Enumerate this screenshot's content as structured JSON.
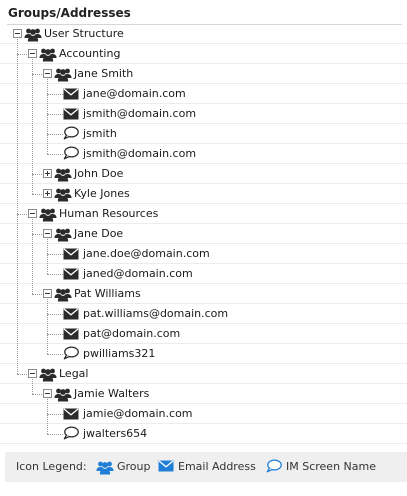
{
  "header": {
    "title": "Groups/Addresses"
  },
  "tree": [
    {
      "depth": 0,
      "icon": "group",
      "label": "User Structure",
      "toggle": "minus"
    },
    {
      "depth": 1,
      "icon": "group",
      "label": "Accounting",
      "toggle": "minus"
    },
    {
      "depth": 2,
      "icon": "group",
      "label": "Jane Smith",
      "toggle": "minus"
    },
    {
      "depth": 3,
      "icon": "email",
      "label": "jane@domain.com"
    },
    {
      "depth": 3,
      "icon": "email",
      "label": "jsmith@domain.com"
    },
    {
      "depth": 3,
      "icon": "im",
      "label": "jsmith"
    },
    {
      "depth": 3,
      "icon": "im",
      "label": "jsmith@domain.com"
    },
    {
      "depth": 2,
      "icon": "group",
      "label": "John Doe",
      "toggle": "plus"
    },
    {
      "depth": 2,
      "icon": "group",
      "label": "Kyle Jones",
      "toggle": "plus"
    },
    {
      "depth": 1,
      "icon": "group",
      "label": "Human Resources",
      "toggle": "minus"
    },
    {
      "depth": 2,
      "icon": "group",
      "label": "Jane Doe",
      "toggle": "minus"
    },
    {
      "depth": 3,
      "icon": "email",
      "label": "jane.doe@domain.com"
    },
    {
      "depth": 3,
      "icon": "email",
      "label": "janed@domain.com"
    },
    {
      "depth": 2,
      "icon": "group",
      "label": "Pat Williams",
      "toggle": "minus"
    },
    {
      "depth": 3,
      "icon": "email",
      "label": "pat.williams@domain.com"
    },
    {
      "depth": 3,
      "icon": "email",
      "label": "pat@domain.com"
    },
    {
      "depth": 3,
      "icon": "im",
      "label": "pwilliams321"
    },
    {
      "depth": 1,
      "icon": "group",
      "label": "Legal",
      "toggle": "minus"
    },
    {
      "depth": 2,
      "icon": "group",
      "label": "Jamie Walters",
      "toggle": "minus"
    },
    {
      "depth": 3,
      "icon": "email",
      "label": "jamie@domain.com"
    },
    {
      "depth": 3,
      "icon": "im",
      "label": "jwalters654"
    }
  ],
  "legend": {
    "title": "Icon Legend:",
    "items": [
      {
        "icon": "group",
        "label": "Group"
      },
      {
        "icon": "email",
        "label": "Email Address"
      },
      {
        "icon": "im",
        "label": "IM Screen Name"
      }
    ]
  },
  "icons": {
    "group": "group-icon",
    "email": "envelope-icon",
    "im": "speech-bubble-icon"
  },
  "colors": {
    "icon_dark": "#2b2b2b",
    "legend_icon": "#1f7fd6",
    "legend_bg": "#efefef"
  }
}
